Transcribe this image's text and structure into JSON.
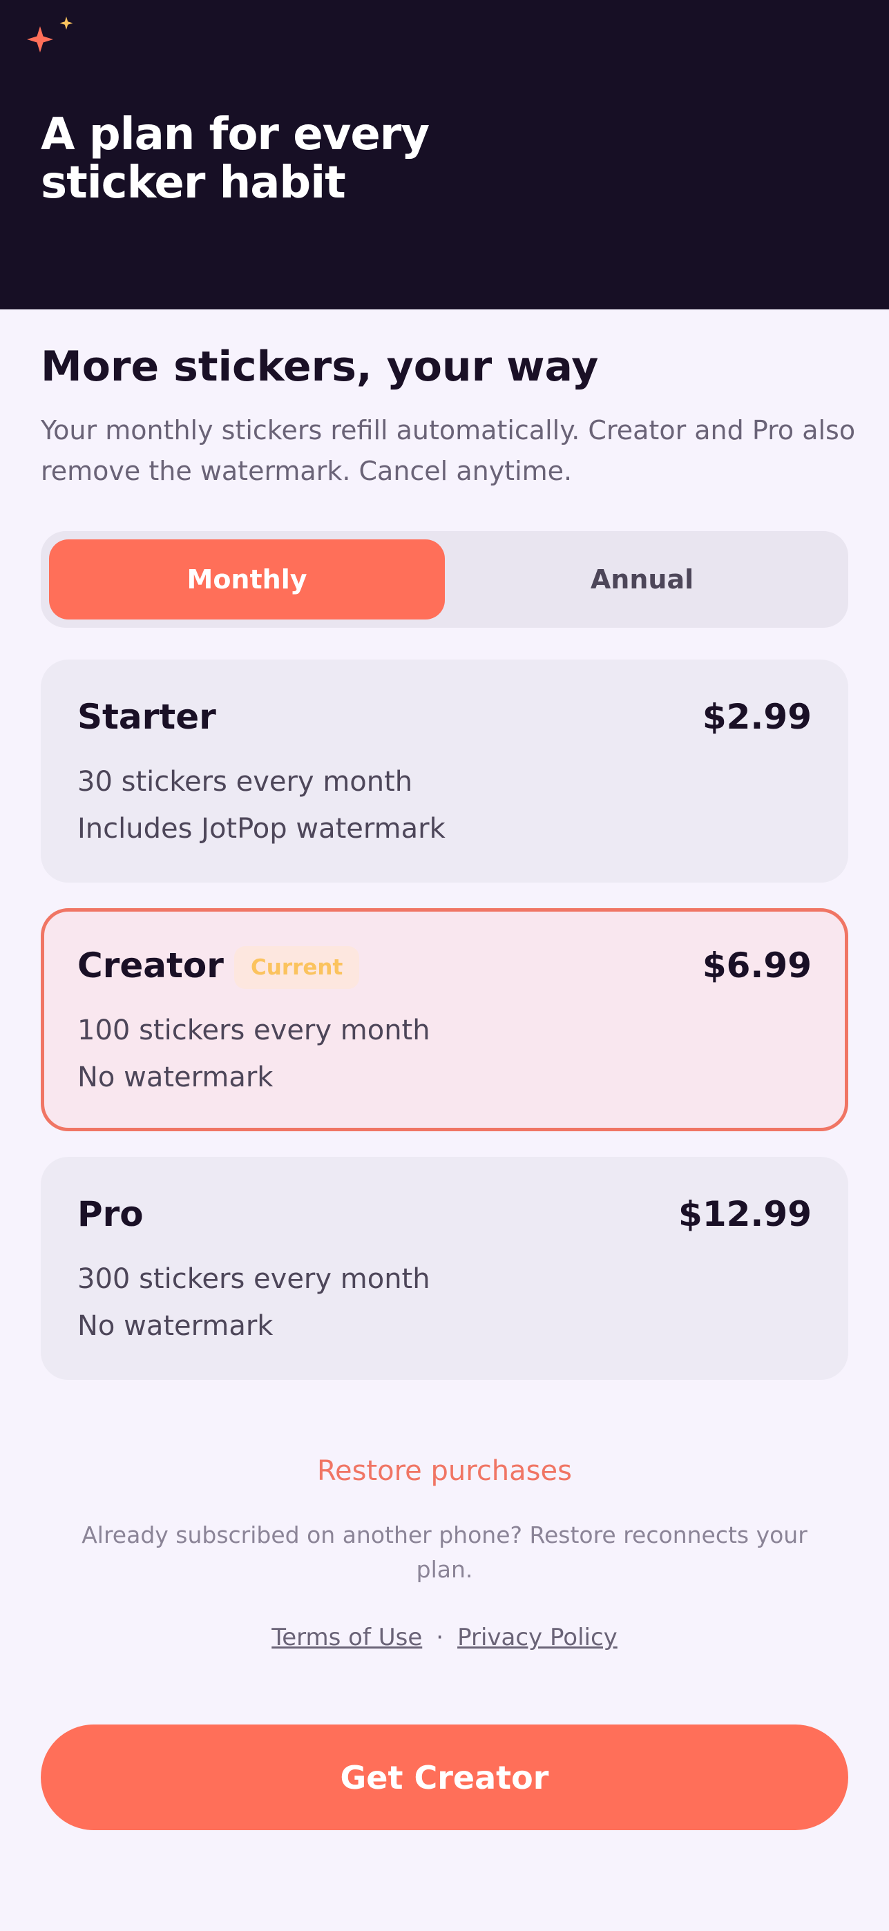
{
  "hero": {
    "title": "A plan for every sticker habit"
  },
  "intro": {
    "headline": "More stickers, your way",
    "subcopy": "Your monthly stickers refill automatically. Creator and Pro also remove the watermark. Cancel anytime."
  },
  "billing_toggle": {
    "selected": "Monthly",
    "options": [
      "Monthly",
      "Annual"
    ]
  },
  "plans": [
    {
      "name": "Starter",
      "price": "$2.99",
      "line1": "30 stickers every month",
      "line2": "Includes JotPop watermark",
      "current": false
    },
    {
      "name": "Creator",
      "badge": "Current",
      "price": "$6.99",
      "line1": "100 stickers every month",
      "line2": "No watermark",
      "current": true
    },
    {
      "name": "Pro",
      "price": "$12.99",
      "line1": "300 stickers every month",
      "line2": "No watermark",
      "current": false
    }
  ],
  "restore": {
    "link_label": "Restore purchases",
    "note": "Already subscribed on another phone? Restore reconnects your plan."
  },
  "legal": {
    "terms": "Terms of Use",
    "separator": "·",
    "privacy": "Privacy Policy"
  },
  "cta": {
    "label": "Get Creator"
  },
  "colors": {
    "hero_background": "#170f25",
    "accent": "#ff6f59",
    "accent_border": "#f07564",
    "page_background": "#f7f3fd",
    "badge_text": "#fbc35e",
    "sparkle_large": "#ff6f59",
    "sparkle_small": "#fbc35e"
  },
  "icons": {
    "hero_decoration": "sparkles-icon"
  }
}
